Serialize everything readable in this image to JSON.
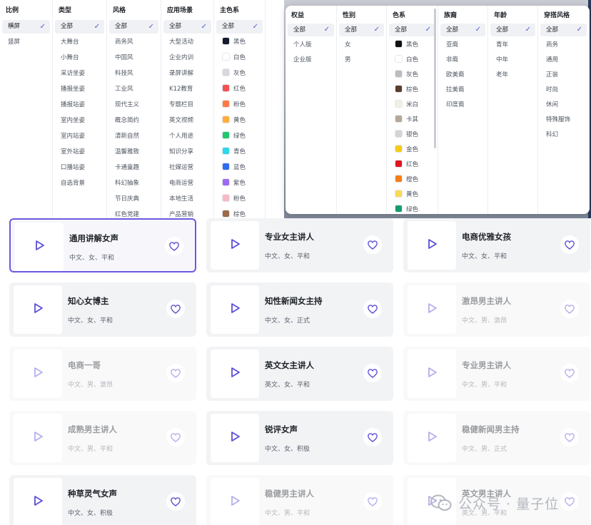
{
  "panel1": {
    "columns": [
      {
        "title": "比例",
        "options": [
          {
            "label": "横屏",
            "selected": true
          },
          {
            "label": "竖屏"
          }
        ]
      },
      {
        "title": "类型",
        "options": [
          {
            "label": "全部",
            "selected": true
          },
          {
            "label": "大舞台"
          },
          {
            "label": "小舞台"
          },
          {
            "label": "采访坐姿"
          },
          {
            "label": "播报坐姿"
          },
          {
            "label": "播报站姿"
          },
          {
            "label": "室内坐姿"
          },
          {
            "label": "室内站姿"
          },
          {
            "label": "室外站姿"
          },
          {
            "label": "口播站姿"
          },
          {
            "label": "自选背景"
          }
        ]
      },
      {
        "title": "风格",
        "options": [
          {
            "label": "全部",
            "selected": true
          },
          {
            "label": "商务风"
          },
          {
            "label": "中国风"
          },
          {
            "label": "科技风"
          },
          {
            "label": "工业风"
          },
          {
            "label": "现代主义"
          },
          {
            "label": "概念简约"
          },
          {
            "label": "清新自然"
          },
          {
            "label": "温馨雅致"
          },
          {
            "label": "卡通童趣"
          },
          {
            "label": "科幻抽象"
          },
          {
            "label": "节日庆典"
          },
          {
            "label": "红色党建"
          }
        ]
      },
      {
        "title": "应用场景",
        "options": [
          {
            "label": "全部",
            "selected": true
          },
          {
            "label": "大型活动"
          },
          {
            "label": "企业内训"
          },
          {
            "label": "录屏讲解"
          },
          {
            "label": "K12教育"
          },
          {
            "label": "专题栏目"
          },
          {
            "label": "英文视频"
          },
          {
            "label": "个人用途"
          },
          {
            "label": "知识分享"
          },
          {
            "label": "社媒运营"
          },
          {
            "label": "电商运营"
          },
          {
            "label": "本地生活"
          },
          {
            "label": "产品营销"
          }
        ]
      },
      {
        "title": "主色系",
        "options": [
          {
            "label": "全部",
            "selected": true
          },
          {
            "label": "黑色",
            "color": "#141b2d"
          },
          {
            "label": "白色",
            "color": "#ffffff"
          },
          {
            "label": "灰色",
            "color": "#d7d9de"
          },
          {
            "label": "红色",
            "color": "#f3524f"
          },
          {
            "label": "粉色",
            "color": "#ff7a45"
          },
          {
            "label": "黄色",
            "color": "#ffae3d"
          },
          {
            "label": "绿色",
            "color": "#1fc96b"
          },
          {
            "label": "青色",
            "color": "#2ed8ea"
          },
          {
            "label": "蓝色",
            "color": "#2f6cf0"
          },
          {
            "label": "紫色",
            "color": "#9b6bf2"
          },
          {
            "label": "粉色",
            "color": "#f7b9c6"
          },
          {
            "label": "棕色",
            "color": "#9a6a4a"
          }
        ]
      }
    ]
  },
  "panel2": {
    "columns": [
      {
        "title": "权益",
        "options": [
          {
            "label": "全部",
            "selected": true
          },
          {
            "label": "个人版"
          },
          {
            "label": "企业版"
          }
        ]
      },
      {
        "title": "性别",
        "options": [
          {
            "label": "全部",
            "selected": true
          },
          {
            "label": "女"
          },
          {
            "label": "男"
          }
        ]
      },
      {
        "title": "色系",
        "options": [
          {
            "label": "全部",
            "selected": true
          },
          {
            "label": "黑色",
            "color": "#111111"
          },
          {
            "label": "白色",
            "color": "#ffffff"
          },
          {
            "label": "灰色",
            "color": "#bdbdbd"
          },
          {
            "label": "棕色",
            "color": "#5a3f2e"
          },
          {
            "label": "米白",
            "color": "#f3efe3"
          },
          {
            "label": "卡其",
            "color": "#b4a898"
          },
          {
            "label": "银色",
            "color": "#d4d4d4"
          },
          {
            "label": "金色",
            "color": "#f5cc1a"
          },
          {
            "label": "红色",
            "color": "#e0151f"
          },
          {
            "label": "橙色",
            "color": "#f57f17"
          },
          {
            "label": "黄色",
            "color": "#f7db55"
          },
          {
            "label": "绿色",
            "color": "#159e6c"
          }
        ]
      },
      {
        "title": "族裔",
        "options": [
          {
            "label": "全部",
            "selected": true
          },
          {
            "label": "亚裔"
          },
          {
            "label": "非裔"
          },
          {
            "label": "欧美裔"
          },
          {
            "label": "拉美裔"
          },
          {
            "label": "印度裔"
          }
        ]
      },
      {
        "title": "年龄",
        "options": [
          {
            "label": "全部",
            "selected": true
          },
          {
            "label": "青年"
          },
          {
            "label": "中年"
          },
          {
            "label": "老年"
          }
        ]
      },
      {
        "title": "穿搭风格",
        "options": [
          {
            "label": "全部",
            "selected": true
          },
          {
            "label": "商务"
          },
          {
            "label": "通用"
          },
          {
            "label": "正装"
          },
          {
            "label": "时尚"
          },
          {
            "label": "休闲"
          },
          {
            "label": "特殊服饰"
          },
          {
            "label": "科幻"
          }
        ]
      }
    ]
  },
  "cards": [
    {
      "name": "通用讲解女声",
      "tags": "中文、女、平和",
      "selected": true
    },
    {
      "name": "专业女主讲人",
      "tags": "中文、女、平和"
    },
    {
      "name": "电商优雅女孩",
      "tags": "中文、女、平和"
    },
    {
      "name": "知心女博主",
      "tags": "中文、女、平和"
    },
    {
      "name": "知性新闻女主持",
      "tags": "中文、女、正式"
    },
    {
      "name": "激昂男主讲人",
      "tags": "中文、男、激昂",
      "faded": true
    },
    {
      "name": "电商一哥",
      "tags": "中文、男、激昂",
      "faded": true
    },
    {
      "name": "英文女主讲人",
      "tags": "英文、女、平和"
    },
    {
      "name": "专业男主讲人",
      "tags": "中文、男、平和",
      "faded": true
    },
    {
      "name": "成熟男主讲人",
      "tags": "中文、男、平和",
      "faded": true
    },
    {
      "name": "锐评女声",
      "tags": "中文、女、积极"
    },
    {
      "name": "稳健新闻男主持",
      "tags": "中文、男、正式",
      "faded": true
    },
    {
      "name": "种草灵气女声",
      "tags": "中文、女、积极"
    },
    {
      "name": "稳健男主讲人",
      "tags": "中文、男、平和",
      "faded": true
    },
    {
      "name": "英文男主讲人",
      "tags": "英文、男、平和",
      "faded": true
    }
  ],
  "watermark": {
    "text": "公众号 · 量子位"
  },
  "colors": {
    "accent": "#4b5bd8",
    "selected_border": "#6a5ae0",
    "card_bg": "#f2f3f5"
  }
}
